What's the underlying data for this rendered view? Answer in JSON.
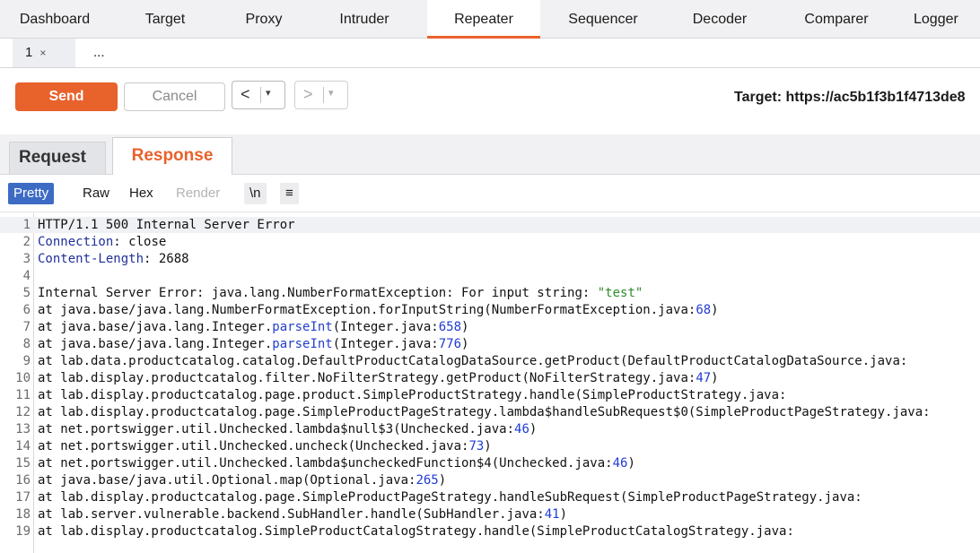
{
  "top_tabs": [
    "Dashboard",
    "Target",
    "Proxy",
    "Intruder",
    "Repeater",
    "Sequencer",
    "Decoder",
    "Comparer",
    "Logger"
  ],
  "active_top_tab": "Repeater",
  "repeater_tabs": [
    {
      "label": "1",
      "close": "×"
    },
    {
      "label": "..."
    }
  ],
  "toolbar": {
    "send_label": "Send",
    "cancel_label": "Cancel",
    "back_arrow": "<",
    "forward_arrow": ">",
    "dropdown_glyph": "▾",
    "target_label": "Target: https://ac5b1f3b1f4713de8"
  },
  "panel_tabs": {
    "request": "Request",
    "response": "Response",
    "active": "Response"
  },
  "view_modes": {
    "pretty": "Pretty",
    "raw": "Raw",
    "hex": "Hex",
    "render": "Render",
    "newline": "\\n",
    "menu": "≡",
    "active": "Pretty"
  },
  "response_lines": [
    {
      "n": "1",
      "text": "HTTP/1.1 500 Internal Server Error"
    },
    {
      "n": "2",
      "key": "Connection",
      "text": ": close"
    },
    {
      "n": "3",
      "key": "Content-Length",
      "text": ": 2688"
    },
    {
      "n": "4",
      "text": ""
    },
    {
      "n": "5",
      "pre": "Internal Server Error: java.lang.NumberFormatException: For input string: ",
      "str": "\"test\""
    },
    {
      "n": "6",
      "pre": "at java.base/java.lang.NumberFormatException.forInputString(NumberFormatException.java:",
      "num": "68",
      "post": ")"
    },
    {
      "n": "7",
      "pre": "at java.base/java.lang.Integer.",
      "method": "parseInt",
      "mid": "(Integer.java:",
      "num": "658",
      "post": ")"
    },
    {
      "n": "8",
      "pre": "at java.base/java.lang.Integer.",
      "method": "parseInt",
      "mid": "(Integer.java:",
      "num": "776",
      "post": ")"
    },
    {
      "n": "9",
      "pre": "at lab.data.productcatalog.catalog.DefaultProductCatalogDataSource.getProduct(DefaultProductCatalogDataSource.java:"
    },
    {
      "n": "10",
      "pre": "at lab.display.productcatalog.filter.NoFilterStrategy.getProduct(NoFilterStrategy.java:",
      "num": "47",
      "post": ")"
    },
    {
      "n": "11",
      "pre": "at lab.display.productcatalog.page.product.SimpleProductStrategy.handle(SimpleProductStrategy.java:"
    },
    {
      "n": "12",
      "pre": "at lab.display.productcatalog.page.SimpleProductPageStrategy.lambda$handleSubRequest$0(SimpleProductPageStrategy.java:"
    },
    {
      "n": "13",
      "pre": "at net.portswigger.util.Unchecked.lambda$null$3(Unchecked.java:",
      "num": "46",
      "post": ")"
    },
    {
      "n": "14",
      "pre": "at net.portswigger.util.Unchecked.uncheck(Unchecked.java:",
      "num": "73",
      "post": ")"
    },
    {
      "n": "15",
      "pre": "at net.portswigger.util.Unchecked.lambda$uncheckedFunction$4(Unchecked.java:",
      "num": "46",
      "post": ")"
    },
    {
      "n": "16",
      "pre": "at java.base/java.util.Optional.map(Optional.java:",
      "num": "265",
      "post": ")"
    },
    {
      "n": "17",
      "pre": "at lab.display.productcatalog.page.SimpleProductPageStrategy.handleSubRequest(SimpleProductPageStrategy.java:"
    },
    {
      "n": "18",
      "pre": "at lab.server.vulnerable.backend.SubHandler.handle(SubHandler.java:",
      "num": "41",
      "post": ")"
    },
    {
      "n": "19",
      "pre": "at lab.display.productcatalog.SimpleProductCatalogStrategy.handle(SimpleProductCatalogStrategy.java:"
    }
  ],
  "colors": {
    "accent": "#e8622c",
    "active_mode": "#3d6bc4",
    "header_key": "#1f2f9b",
    "number": "#1f3bd6",
    "string": "#2e8b2e"
  }
}
